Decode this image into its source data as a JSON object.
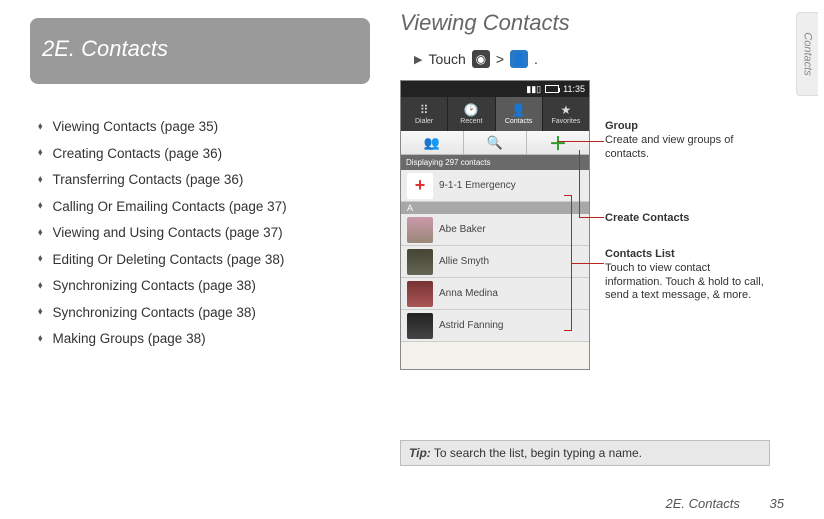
{
  "section_header": "2E.  Contacts",
  "toc": [
    "Viewing Contacts (page 35)",
    "Creating Contacts (page 36)",
    "Transferring Contacts (page 36)",
    "Calling Or Emailing Contacts (page 37)",
    "Viewing and Using Contacts (page 37)",
    "Editing Or Deleting Contacts (page 38)",
    "Synchronizing Contacts (page 38)",
    "Synchronizing Contacts (page 38)",
    "Making Groups (page 38)"
  ],
  "heading": "Viewing Contacts",
  "step": {
    "pre": "Touch",
    "mid": ">",
    "post": "."
  },
  "phone": {
    "time": "11:35",
    "tabs": [
      "Dialer",
      "Recent",
      "Contacts",
      "Favorites"
    ],
    "active_tab_index": 2,
    "count_bar": "Displaying 297 contacts",
    "emergency": "9-1-1 Emergency",
    "alpha_header": "A",
    "contacts": [
      "Abe Baker",
      "Allie Smyth",
      "Anna Medina",
      "Astrid Fanning"
    ]
  },
  "callouts": {
    "group": {
      "title": "Group",
      "body": "Create and view groups of contacts."
    },
    "create": {
      "title": "Create Contacts"
    },
    "list": {
      "title": "Contacts  List",
      "body": "Touch to view contact information. Touch & hold to call, send a text message, & more."
    }
  },
  "tip": {
    "label": "Tip:",
    "text": " To search the list, begin typing a name."
  },
  "footer": {
    "section": "2E. Contacts",
    "page": "35"
  },
  "sidetab": "Contacts"
}
